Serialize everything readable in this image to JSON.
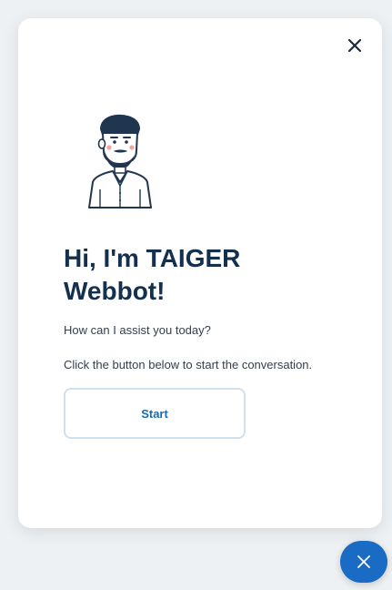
{
  "chat_window": {
    "close_icon": "close-icon",
    "avatar_icon": "bearded-man-avatar",
    "title": "Hi, I'm TAIGER Webbot!",
    "subtitle": "How can I assist you today?",
    "instruction": "Click the button below to start the conversation.",
    "start_label": "Start"
  },
  "launcher": {
    "icon": "close-icon"
  },
  "colors": {
    "background": "#eef1f3",
    "card": "#ffffff",
    "title": "#13304e",
    "body_text": "#333f4d",
    "accent": "#1a6bc4",
    "button_border": "#cfe0ef"
  }
}
